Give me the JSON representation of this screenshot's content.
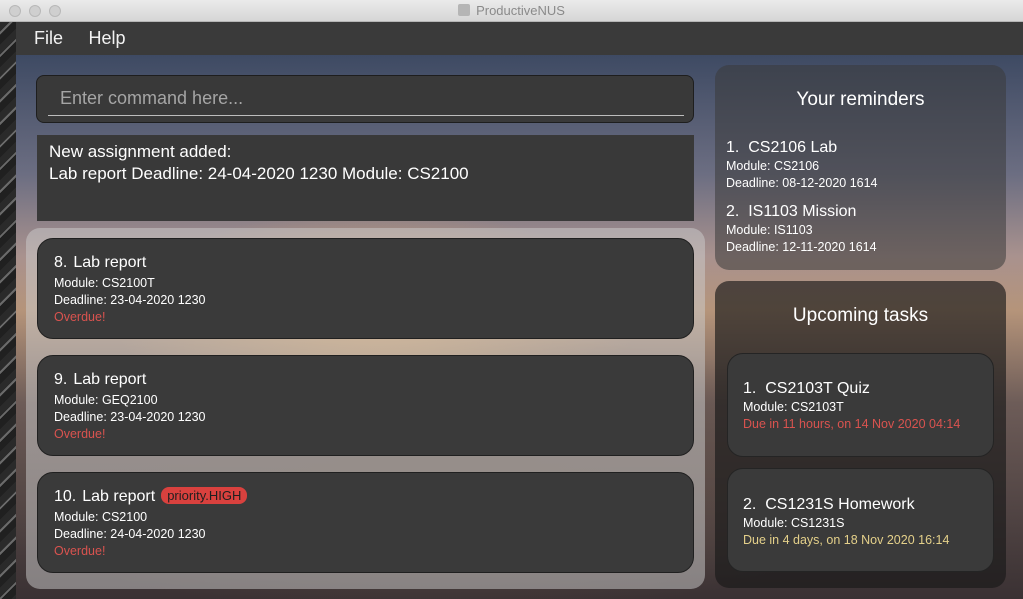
{
  "window": {
    "title": "ProductiveNUS"
  },
  "menu": {
    "file_label": "File",
    "help_label": "Help"
  },
  "command": {
    "placeholder": "Enter command here...",
    "value": ""
  },
  "result": {
    "line1": "New assignment added:",
    "line2": "Lab report Deadline: 24-04-2020 1230 Module: CS2100"
  },
  "tasks": [
    {
      "index": "8.",
      "name": "Lab report",
      "module": "Module: CS2100T",
      "deadline": "Deadline: 23-04-2020 1230",
      "status": "Overdue!",
      "priority": ""
    },
    {
      "index": "9.",
      "name": "Lab report",
      "module": "Module: GEQ2100",
      "deadline": "Deadline: 23-04-2020 1230",
      "status": "Overdue!",
      "priority": ""
    },
    {
      "index": "10.",
      "name": "Lab report",
      "module": "Module: CS2100",
      "deadline": "Deadline: 24-04-2020 1230",
      "status": "Overdue!",
      "priority": "priority.HIGH"
    }
  ],
  "reminders": {
    "title": "Your reminders",
    "items": [
      {
        "index": "1.",
        "name": "CS2106 Lab",
        "module": "Module: CS2106",
        "deadline": "Deadline: 08-12-2020 1614"
      },
      {
        "index": "2.",
        "name": "IS1103 Mission",
        "module": "Module: IS1103",
        "deadline": "Deadline: 12-11-2020 1614"
      }
    ]
  },
  "upcoming": {
    "title": "Upcoming tasks",
    "items": [
      {
        "index": "1.",
        "name": "CS2103T Quiz",
        "module": "Module: CS2103T",
        "due": "Due in 11 hours, on 14 Nov 2020 04:14",
        "due_color": "#d9534f"
      },
      {
        "index": "2.",
        "name": "CS1231S Homework",
        "module": "Module: CS1231S",
        "due": "Due in 4 days, on 18 Nov 2020 16:14",
        "due_color": "#e4d08a"
      }
    ]
  },
  "colors": {
    "overdue": "#d9534f",
    "priority_high": "#d9413e",
    "card_bg": "#3a3a3a"
  }
}
